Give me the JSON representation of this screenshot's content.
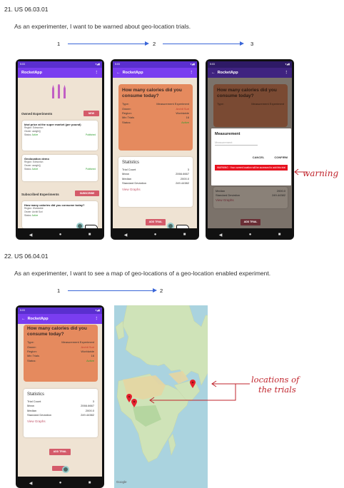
{
  "section21": {
    "heading": "21. US 06.03.01",
    "story": "As an experimenter, I want to be warned about geo-location trials.",
    "steps": [
      "1",
      "2",
      "3"
    ],
    "phone1": {
      "status_time": "5:03",
      "app_title": "RocketApp",
      "owned_label": "Owned Experiments",
      "new_btn": "NEW",
      "exp1_title": "kiwi price at the super market (per pound)",
      "exp1_region": "Region: Edmonton",
      "exp1_owner": "Owner: aanghi()",
      "exp1_status": "Status: ",
      "exp1_status_val": "Active",
      "exp1_pub": "Published",
      "exp2_title": "Geolocation demo",
      "exp2_region": "Region: Edmonton",
      "exp2_owner": "Owner: aanghi()",
      "exp2_status": "Status: ",
      "exp2_status_val": "Active",
      "exp2_pub": "Published",
      "sub_label": "Subscribed Experiments",
      "subscribe_btn": "SUBSCRIBE",
      "exp3_title": "How many calories did you consume today?",
      "exp3_region": "Region: Worldwide",
      "exp3_owner": "Owner: Archit Suri",
      "exp3_status": "Status: ",
      "exp3_status_val": "Active"
    },
    "phone2": {
      "status_time": "5:03",
      "app_title": "RocketApp",
      "q": "How many calories did you consume today?",
      "type_k": "Type:",
      "type_v": "Measurement Experiment",
      "owner_k": "Owner:",
      "owner_v": "Archit Suri",
      "region_k": "Region:",
      "region_v": "Worldwide",
      "min_k": "Min Trials",
      "min_v": "16",
      "status_k": "Status:",
      "status_v": "Active",
      "stats_title": "Statistics",
      "count_k": "Trial Count",
      "count_v": "3",
      "mean_k": "Mean",
      "mean_v": "2066.6667",
      "median_k": "Median",
      "median_v": "2000.0",
      "std_k": "Standard Deviation",
      "std_v": "249.44382",
      "view_graphs": "View Graphs",
      "add_trial": "ADD TRIAL"
    },
    "phone3": {
      "status_time": "5:03",
      "app_title": "RocketApp",
      "q": "How many calories did you consume today?",
      "type_k": "Type:",
      "type_v": "Measurement Experiment",
      "dialog_title": "Measurement",
      "dialog_placeholder": "Measurement",
      "cancel": "CANCEL",
      "confirm": "CONFIRM",
      "warning": "WARNING : Your current location will be accessed to add this trial",
      "std_k": "Standard Deviation",
      "std_v": "249.44382",
      "median_k": "Median",
      "median_v": "2000.0",
      "view_graphs": "View Graphs",
      "add_trial": "ADD TRIAL"
    },
    "annotation": "warning"
  },
  "section22": {
    "heading": "22. US 06.04.01",
    "story": "As an experimenter, I want to see a map of geo-locations of a geo-location enabled experiment.",
    "steps": [
      "1",
      "2"
    ],
    "phone": {
      "status_time": "5:03",
      "app_title": "RocketApp",
      "q": "How many calories did you consume today?",
      "type_k": "Type:",
      "type_v": "Measurement Experiment",
      "owner_k": "Owner:",
      "owner_v": "Archit Suri",
      "region_k": "Region:",
      "region_v": "Worldwide",
      "min_k": "Min Trials",
      "min_v": "16",
      "status_k": "Status:",
      "status_v": "Active",
      "stats_title": "Statistics",
      "count_k": "Trial Count",
      "count_v": "3",
      "mean_k": "Mean",
      "mean_v": "2066.6667",
      "median_k": "Median",
      "median_v": "2000.0",
      "std_k": "Standard Deviation",
      "std_v": "249.44382",
      "view_graphs": "View Graphs",
      "add_trial": "ADD TRIAL"
    },
    "map_credit": "Google",
    "annotation_line1": "locations of",
    "annotation_line2": "the trials"
  },
  "colors": {
    "arrow": "#3a66d8",
    "appbar": "#7a3df0",
    "accent": "#d45b6a",
    "card_orange": "#e58a5e",
    "annotation": "#c0242c"
  }
}
